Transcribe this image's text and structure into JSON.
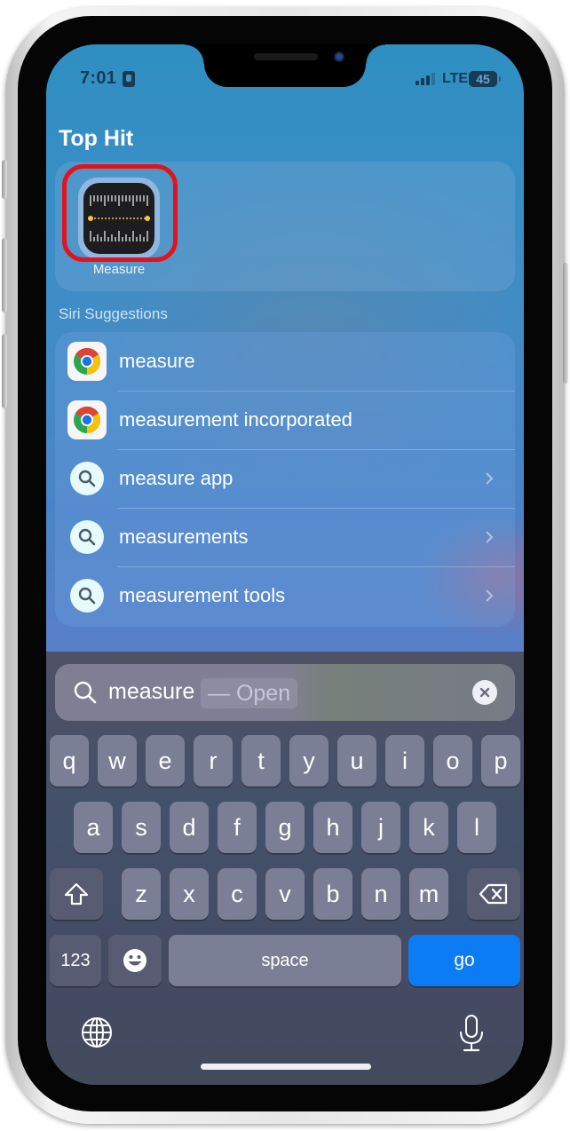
{
  "status_bar": {
    "time": "7:01",
    "network": "LTE",
    "battery": "45",
    "signal_bars_active": 3,
    "signal_bars_total": 4
  },
  "top_hit": {
    "section_title": "Top Hit",
    "app_name": "Measure",
    "app_icon": "measure-ruler-icon",
    "highlight_color": "#e5121b"
  },
  "siri_suggestions": {
    "section_title": "Siri Suggestions",
    "items": [
      {
        "label": "measure",
        "icon": "chrome-icon",
        "chevron": false
      },
      {
        "label": "measurement incorporated",
        "icon": "chrome-icon",
        "chevron": false
      },
      {
        "label": "measure app",
        "icon": "search-icon",
        "chevron": true
      },
      {
        "label": "measurements",
        "icon": "search-icon",
        "chevron": true
      },
      {
        "label": "measurement tools",
        "icon": "search-icon",
        "chevron": true
      }
    ]
  },
  "search": {
    "value": "measure",
    "completion": "— Open",
    "clear_icon": "clear-icon"
  },
  "keyboard": {
    "row1": [
      "q",
      "w",
      "e",
      "r",
      "t",
      "y",
      "u",
      "i",
      "o",
      "p"
    ],
    "row2": [
      "a",
      "s",
      "d",
      "f",
      "g",
      "h",
      "j",
      "k",
      "l"
    ],
    "row3": [
      "z",
      "x",
      "c",
      "v",
      "b",
      "n",
      "m"
    ],
    "shift_icon": "shift-icon",
    "delete_icon": "delete-icon",
    "numbers_label": "123",
    "emoji_icon": "emoji-icon",
    "space_label": "space",
    "go_label": "go",
    "globe_icon": "globe-icon",
    "mic_icon": "mic-icon",
    "accent_color": "#0b7cf4"
  }
}
